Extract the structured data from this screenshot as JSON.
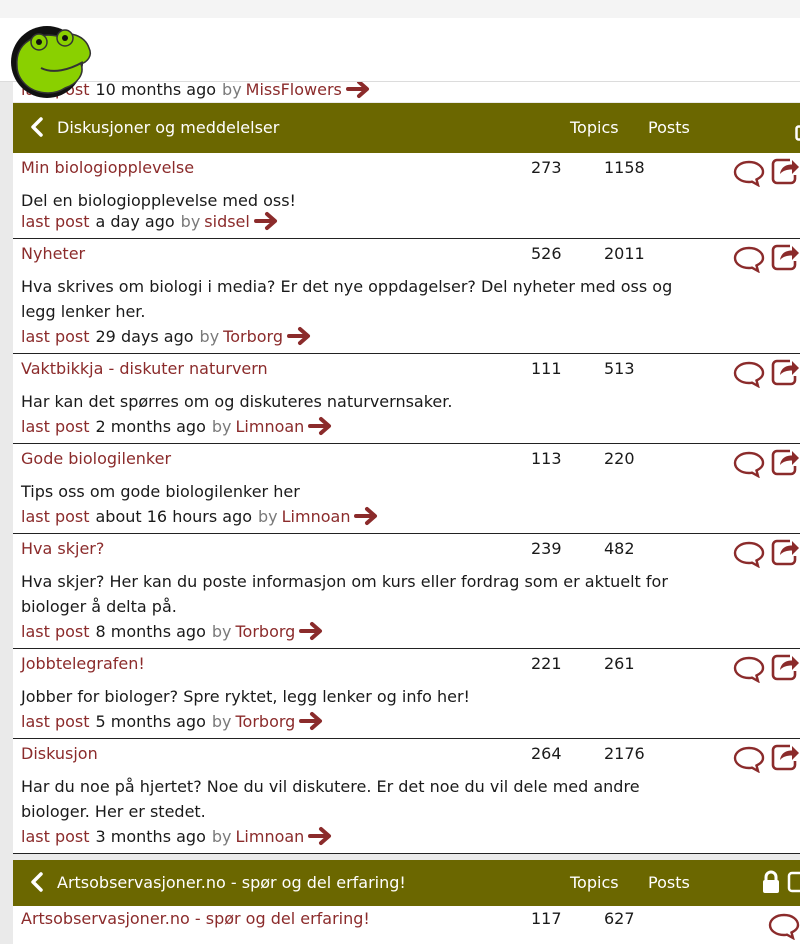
{
  "previous": {
    "last_post_label": "last post",
    "ago": "10 months ago",
    "by": "by",
    "user": "MissFlowers"
  },
  "section1": {
    "title": "Diskusjoner og meddelelser",
    "col_topics": "Topics",
    "col_posts": "Posts",
    "forums": [
      {
        "title": "Min biologiopplevelse",
        "topics": "273",
        "posts": "1158",
        "desc": "Del en biologiopplevelse med oss!",
        "ago": "a day ago",
        "user": "sidsel"
      },
      {
        "title": "Nyheter",
        "topics": "526",
        "posts": "2011",
        "desc": "Hva skrives om biologi i media? Er det nye oppdagelser? Del nyheter med oss og legg lenker her.",
        "ago": "29 days ago",
        "user": "Torborg"
      },
      {
        "title": "Vaktbikkja - diskuter naturvern",
        "topics": "111",
        "posts": "513",
        "desc": "Har kan det spørres om og diskuteres naturvernsaker.",
        "ago": "2 months ago",
        "user": "Limnoan"
      },
      {
        "title": "Gode biologilenker",
        "topics": "113",
        "posts": "220",
        "desc": "Tips oss om gode biologilenker her",
        "ago": "about 16 hours ago",
        "user": "Limnoan"
      },
      {
        "title": "Hva skjer?",
        "topics": "239",
        "posts": "482",
        "desc": "Hva skjer? Her kan du poste informasjon om kurs eller fordrag som er aktuelt for biologer å delta på.",
        "ago": "8 months ago",
        "user": "Torborg"
      },
      {
        "title": "Jobbtelegrafen!",
        "topics": "221",
        "posts": "261",
        "desc": "Jobber for biologer? Spre ryktet, legg lenker og info her!",
        "ago": "5 months ago",
        "user": "Torborg"
      },
      {
        "title": "Diskusjon",
        "topics": "264",
        "posts": "2176",
        "desc": "Har du noe på hjertet? Noe du vil diskutere. Er det noe du vil dele med andre biologer. Her er stedet.",
        "ago": "3 months ago",
        "user": "Limnoan"
      }
    ]
  },
  "section2": {
    "title": "Artsobservasjoner.no - spør og del erfaring!",
    "col_topics": "Topics",
    "col_posts": "Posts",
    "forums": [
      {
        "title": "Artsobservasjoner.no - spør og del erfaring!",
        "topics": "117",
        "posts": "627"
      }
    ]
  },
  "labels": {
    "last_post": "last post",
    "by": "by"
  },
  "icons": {
    "logo": "frog-mascot-logo",
    "back": "chevron-left-icon",
    "reply": "speech-bubble-icon",
    "share": "share-arrow-icon",
    "goto": "right-arrow-icon",
    "lock": "lock-icon"
  },
  "colors": {
    "header_bg": "#6b6700",
    "link": "#8b2b2b"
  }
}
